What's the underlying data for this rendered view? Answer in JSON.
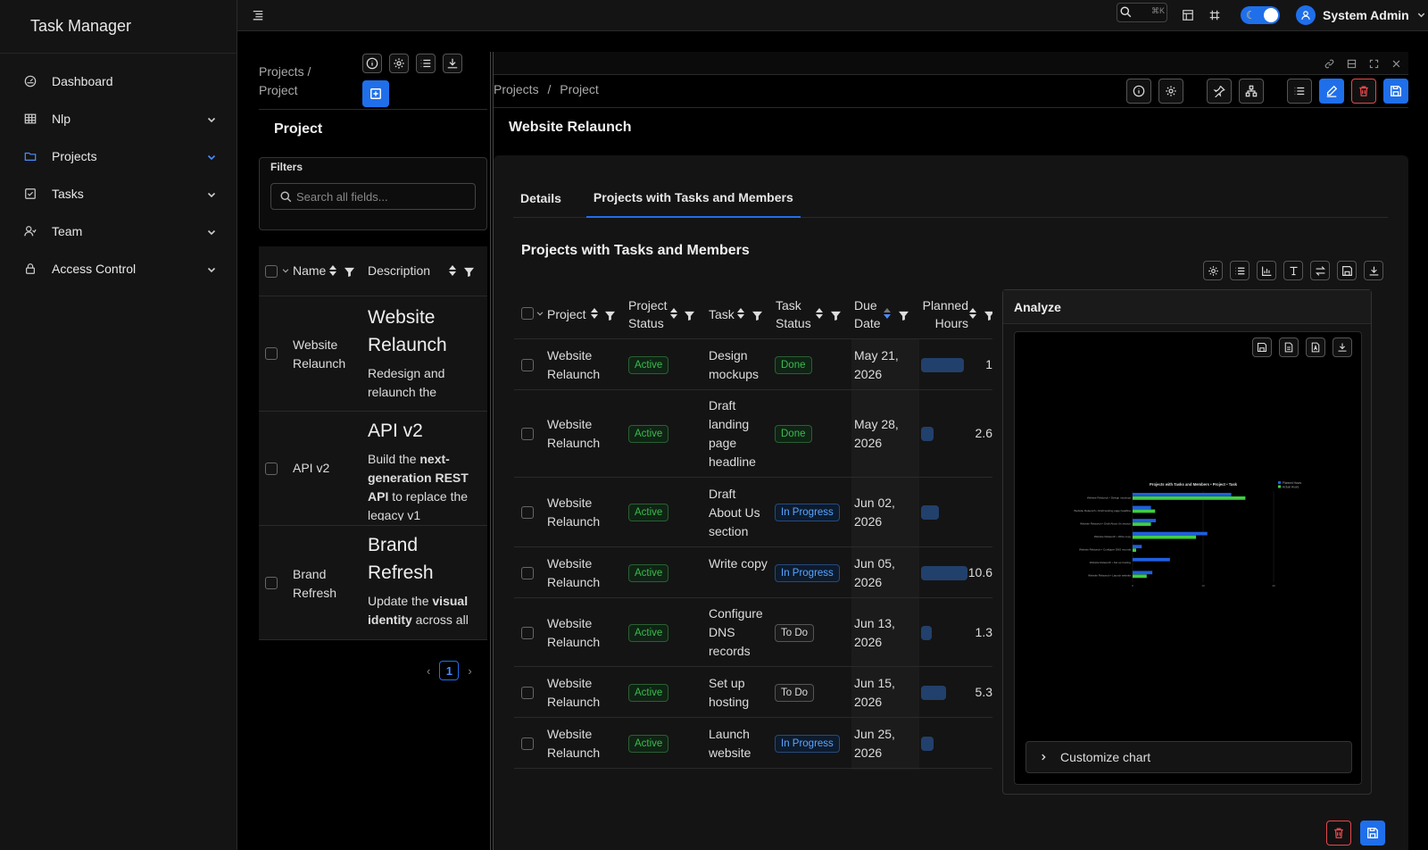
{
  "app": {
    "title": "Task Manager"
  },
  "sidebar": {
    "items": [
      {
        "label": "Dashboard",
        "icon": "dashboard-icon",
        "chevron": false
      },
      {
        "label": "Nlp",
        "icon": "table-icon",
        "chevron": true
      },
      {
        "label": "Projects",
        "icon": "folder-icon",
        "chevron": true,
        "active": true
      },
      {
        "label": "Tasks",
        "icon": "checkbox-icon",
        "chevron": true
      },
      {
        "label": "Team",
        "icon": "team-icon",
        "chevron": true
      },
      {
        "label": "Access Control",
        "icon": "lock-icon",
        "chevron": true
      }
    ]
  },
  "topbar": {
    "search_kbd": "⌘K",
    "user_name": "System Admin",
    "accent": "#1f6feb"
  },
  "list_panel": {
    "breadcrumb": "Projects  /  Project",
    "title": "Project",
    "filters_label": "Filters",
    "search_placeholder": "Search all fields...",
    "columns": {
      "name": "Name",
      "description": "Description"
    },
    "rows": [
      {
        "name": "Website Relaunch",
        "desc_title": "Website Relaunch",
        "desc_text": "Redesign and relaunch the"
      },
      {
        "name": "API v2",
        "desc_title": "API v2",
        "desc_pre": "Build the ",
        "desc_bold": "next-generation REST API",
        "desc_post": " to replace the legacy v1"
      },
      {
        "name": "Brand Refresh",
        "desc_title": "Brand Refresh",
        "desc_pre": "Update the ",
        "desc_bold": "visual identity",
        "desc_post": " across all"
      }
    ],
    "page": "1"
  },
  "detail": {
    "breadcrumb_root": "Projects",
    "breadcrumb_sep": "/",
    "breadcrumb_leaf": "Project",
    "title": "Website Relaunch",
    "tabs": [
      "Details",
      "Projects with Tasks and Members"
    ],
    "section_title": "Projects with Tasks and Members",
    "columns": {
      "project": "Project",
      "project_status_1": "Project",
      "project_status_2": "Status",
      "task": "Task",
      "task_status_1": "Task",
      "task_status_2": "Status",
      "due_1": "Due",
      "due_2": "Date",
      "planned_1": "Planned",
      "planned_2": "Hours"
    },
    "rows": [
      {
        "project": "Website Relaunch",
        "project_status": "Active",
        "task": "Design mockups",
        "task_status": "Done",
        "due": "May 21, 2026",
        "planned_text": "1",
        "planned_fill": 0.6
      },
      {
        "project": "Website Relaunch",
        "project_status": "Active",
        "task": "Draft landing page headline",
        "task_status": "Done",
        "due": "May 28, 2026",
        "planned_text": "2.6",
        "planned_fill": 0.18
      },
      {
        "project": "Website Relaunch",
        "project_status": "Active",
        "task": "Draft About Us section",
        "task_status": "In Progress",
        "due": "Jun 02, 2026",
        "planned_text": "",
        "planned_fill": 0.25
      },
      {
        "project": "Website Relaunch",
        "project_status": "Active",
        "task": "Write copy",
        "task_status": "In Progress",
        "due": "Jun 05, 2026",
        "planned_text": "10.6",
        "planned_fill": 0.65
      },
      {
        "project": "Website Relaunch",
        "project_status": "Active",
        "task": "Configure DNS records",
        "task_status": "To Do",
        "due": "Jun 13, 2026",
        "planned_text": "1.3",
        "planned_fill": 0.1
      },
      {
        "project": "Website Relaunch",
        "project_status": "Active",
        "task": "Set up hosting",
        "task_status": "To Do",
        "due": "Jun 15, 2026",
        "planned_text": "5.3",
        "planned_fill": 0.35
      },
      {
        "project": "Website Relaunch",
        "project_status": "Active",
        "task": "Launch website",
        "task_status": "In Progress",
        "due": "Jun 25, 2026",
        "planned_text": "",
        "planned_fill": 0.18
      }
    ],
    "analyze": {
      "title": "Analyze",
      "customize_label": "Customize chart"
    }
  },
  "chart_data": {
    "type": "bar",
    "orientation": "horizontal",
    "title": "Projects with Tasks and Members • Project • Task",
    "categories": [
      "Website Relaunch • Design mockups",
      "Website Relaunch • Draft landing page headline",
      "Website Relaunch • Draft About Us section",
      "Website Relaunch • Write copy",
      "Website Relaunch • Configure DNS records",
      "Website Relaunch • Set up hosting",
      "Website Relaunch • Launch website"
    ],
    "series": [
      {
        "name": "Planned Hours",
        "color": "#1f5fe0",
        "values": [
          14,
          2.6,
          3.3,
          10.6,
          1.3,
          5.3,
          2.8
        ]
      },
      {
        "name": "Actual Hours",
        "color": "#3fcf3f",
        "values": [
          16,
          3.2,
          2.6,
          9.0,
          0.5,
          0,
          2.0
        ]
      }
    ],
    "xlim": [
      0,
      20
    ],
    "xticks": [
      "0",
      "10",
      "20"
    ],
    "legend": "top-right"
  }
}
